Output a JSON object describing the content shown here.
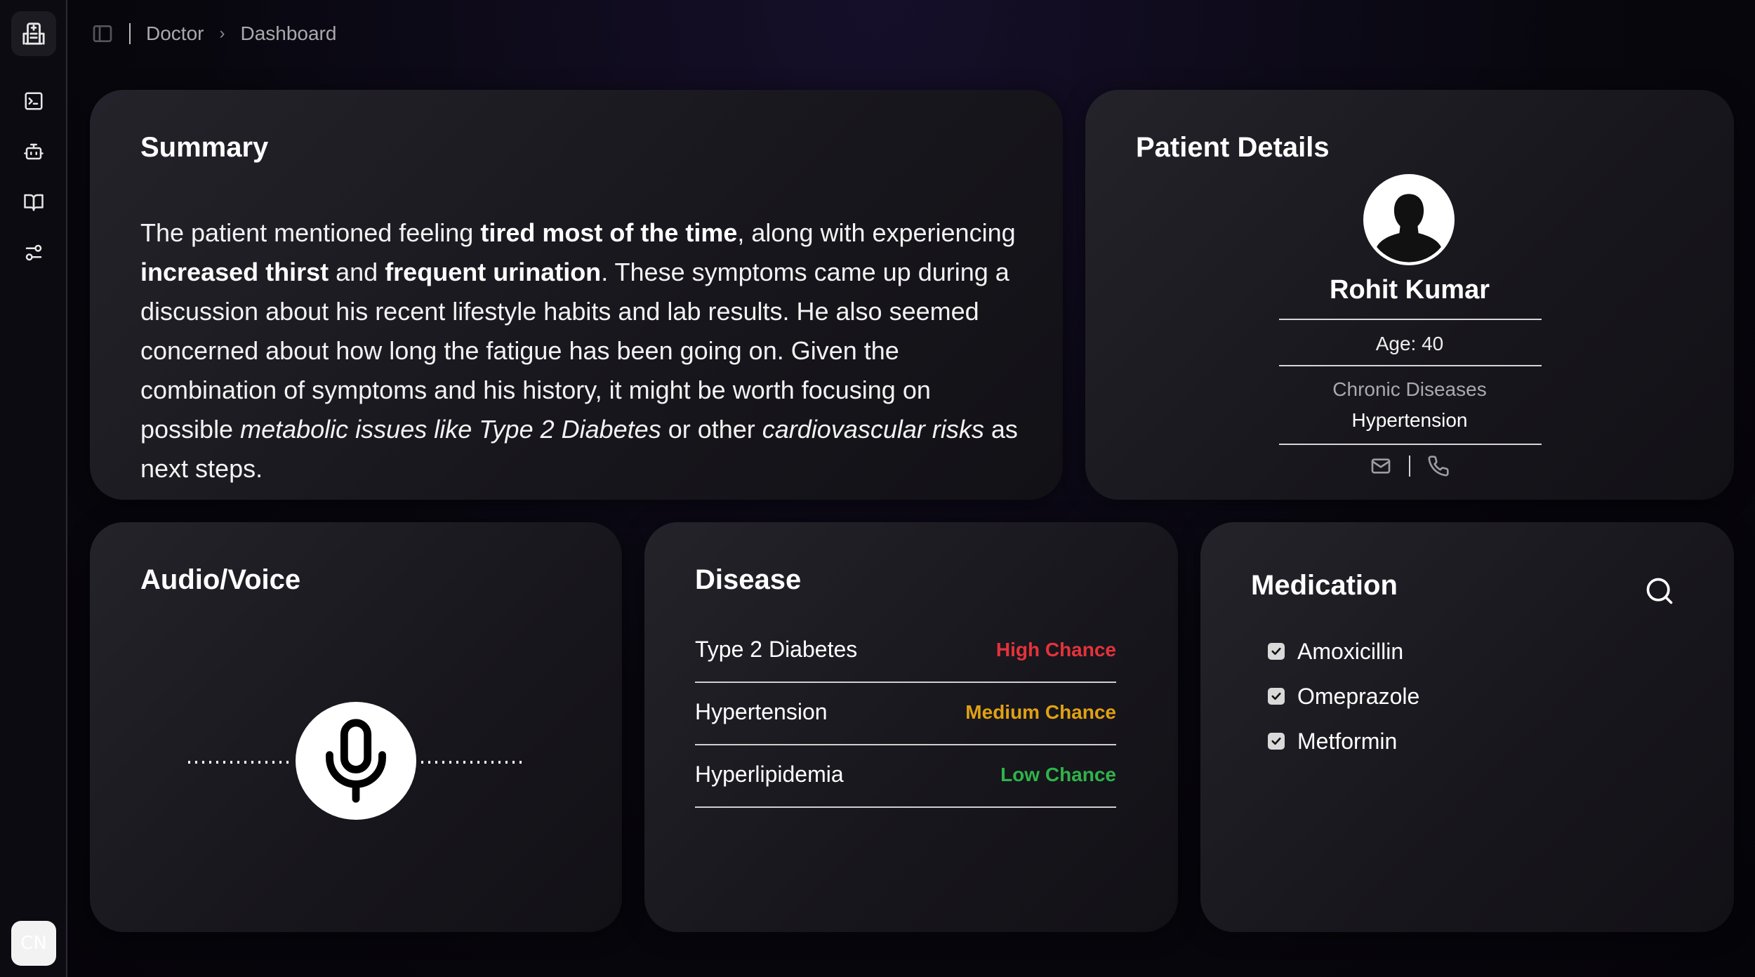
{
  "sidebar": {
    "items": [
      {
        "icon": "terminal-icon"
      },
      {
        "icon": "bot-icon"
      },
      {
        "icon": "book-open-icon"
      },
      {
        "icon": "settings-sliders-icon"
      }
    ],
    "avatar_initials": "CN"
  },
  "breadcrumb": {
    "items": [
      "Doctor",
      "Dashboard"
    ]
  },
  "summary": {
    "title": "Summary",
    "parts": [
      {
        "t": "The patient mentioned feeling ",
        "s": "n"
      },
      {
        "t": "tired most of the time",
        "s": "b"
      },
      {
        "t": ", along with experiencing ",
        "s": "n"
      },
      {
        "t": "increased thirst",
        "s": "b"
      },
      {
        "t": " and ",
        "s": "n"
      },
      {
        "t": "frequent urination",
        "s": "b"
      },
      {
        "t": ". These symptoms came up during a discussion about his recent lifestyle habits and lab results. He also seemed concerned about how long the fatigue has been going on. Given the combination of symptoms and his history, it might be worth focusing on possible ",
        "s": "n"
      },
      {
        "t": "metabolic issues like Type 2 Diabetes",
        "s": "i"
      },
      {
        "t": " or other ",
        "s": "n"
      },
      {
        "t": "cardiovascular risks",
        "s": "i"
      },
      {
        "t": " as next steps.",
        "s": "n"
      }
    ]
  },
  "patient": {
    "title": "Patient Details",
    "name": "Rohit Kumar",
    "age_text": "Age: 40",
    "chronic_label": "Chronic Diseases",
    "chronic_value": "Hypertension"
  },
  "audio": {
    "title": "Audio/Voice"
  },
  "disease": {
    "title": "Disease",
    "items": [
      {
        "name": "Type 2 Diabetes",
        "chance": "High Chance",
        "color": "#e5323a"
      },
      {
        "name": "Hypertension",
        "chance": "Medium Chance",
        "color": "#e0a113"
      },
      {
        "name": "Hyperlipidemia",
        "chance": "Low Chance",
        "color": "#2fb34a"
      }
    ]
  },
  "medication": {
    "title": "Medication",
    "items": [
      {
        "label": "Amoxicillin",
        "checked": true
      },
      {
        "label": "Omeprazole",
        "checked": true
      },
      {
        "label": "Metformin",
        "checked": true
      }
    ]
  }
}
